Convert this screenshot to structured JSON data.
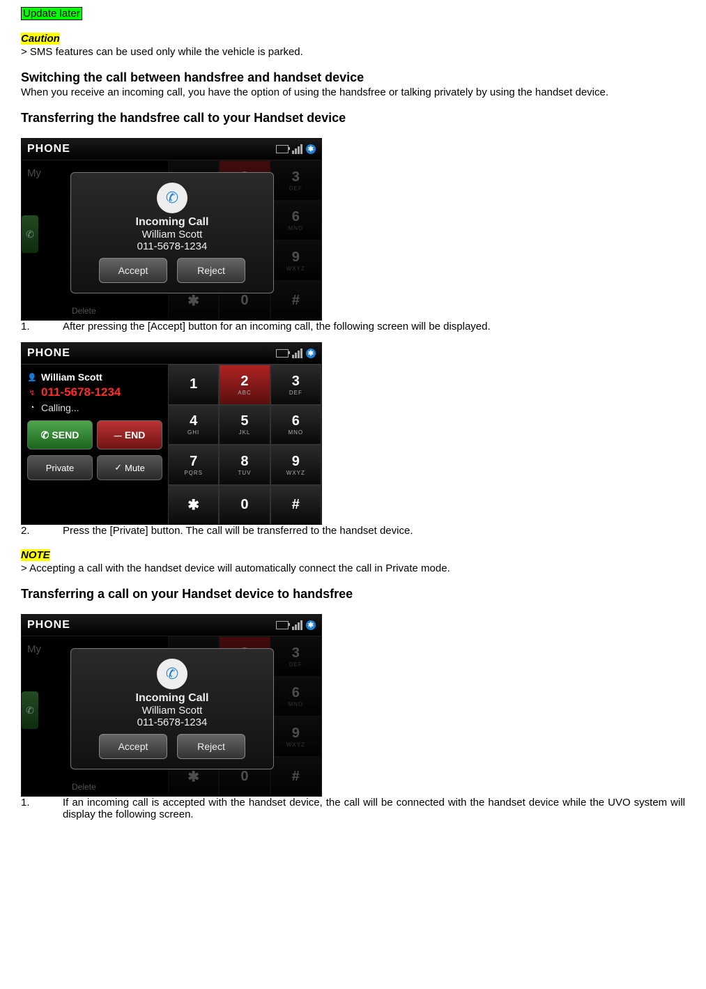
{
  "top_update": "Update later",
  "caution_label": "Caution",
  "caution_text": "> SMS features can be used only while the vehicle is parked.",
  "h_switch": "Switching the call between handsfree and handset device",
  "p_switch": "When you receive an incoming call, you have the option of using the handsfree or talking privately by using the handset device.",
  "h_transfer_to_handset": "Transferring the handsfree call to your Handset device",
  "step1": "After pressing the [Accept] button for an incoming call, the following screen will be displayed.",
  "step2": "Press the [Private] button. The call will be transferred to the handset device.",
  "note_label": "NOTE",
  "note_text": "> Accepting a call with the handset device will automatically connect the call in Private mode.",
  "h_transfer_to_handsfree": "Transferring a call on your Handset device to handsfree",
  "step_b1": "If an incoming call is accepted with the handset device, the call will be connected with the handset device while the UVO system will display the following screen.",
  "ui": {
    "title": "PHONE",
    "bt_glyph": "✱",
    "incoming": {
      "phone_glyph": "✆",
      "line1": "Incoming Call",
      "name": "William Scott",
      "number": "011-5678-1234",
      "accept": "Accept",
      "reject": "Reject",
      "my_label": "My",
      "delete": "Delete",
      "call_glyph": "✆"
    },
    "live": {
      "person_glyph": "👤",
      "name": "William Scott",
      "call_glyph": "↯",
      "number": "011-5678-1234",
      "clock_glyph": "◔",
      "status": "Calling...",
      "send_glyph": "✆",
      "send": "SEND",
      "end_glyph": "⏤",
      "end": "END",
      "private": "Private",
      "mute_glyph": "✓",
      "mute": "Mute"
    },
    "keys": [
      {
        "d": "1",
        "l": ""
      },
      {
        "d": "2",
        "l": "ABC",
        "red": true
      },
      {
        "d": "3",
        "l": "DEF"
      },
      {
        "d": "4",
        "l": "GHI"
      },
      {
        "d": "5",
        "l": "JKL"
      },
      {
        "d": "6",
        "l": "MNO"
      },
      {
        "d": "7",
        "l": "PQRS"
      },
      {
        "d": "8",
        "l": "TUV"
      },
      {
        "d": "9",
        "l": "WXYZ"
      },
      {
        "d": "✱",
        "l": ""
      },
      {
        "d": "0",
        "l": ""
      },
      {
        "d": "#",
        "l": ""
      }
    ]
  }
}
